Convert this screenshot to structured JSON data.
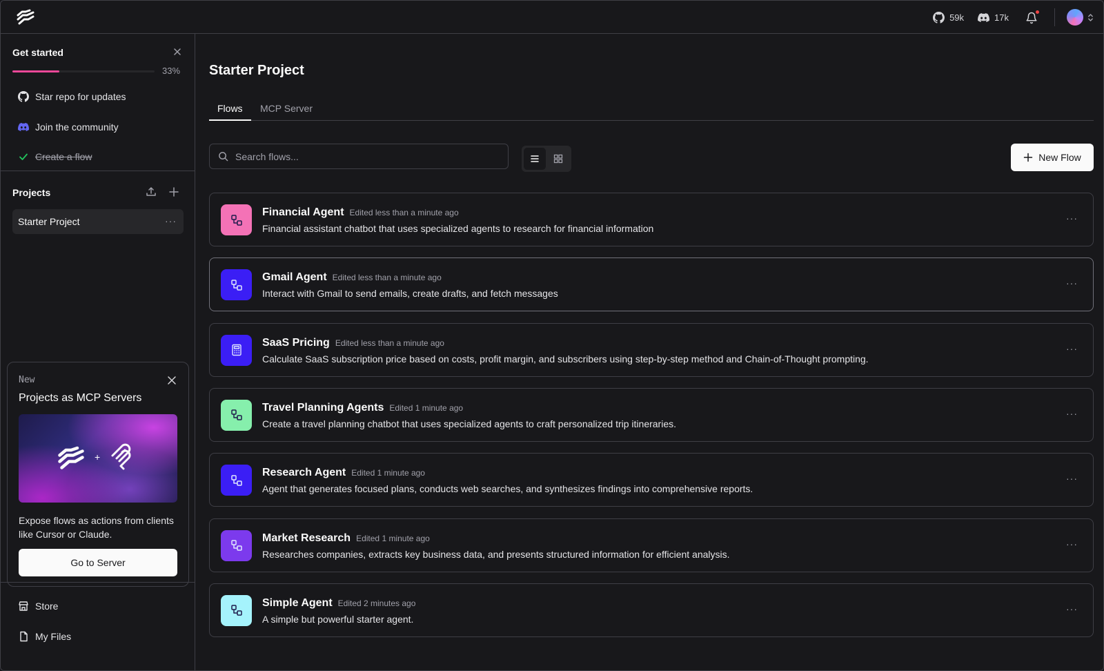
{
  "header": {
    "github_count": "59k",
    "discord_count": "17k"
  },
  "sidebar": {
    "get_started": {
      "title": "Get started",
      "progress_percent": 33,
      "progress_label": "33%",
      "items": [
        {
          "label": "Star repo for updates",
          "icon": "github-icon",
          "done": false
        },
        {
          "label": "Join the community",
          "icon": "discord-icon",
          "done": false
        },
        {
          "label": "Create a flow",
          "icon": "check-icon",
          "done": true
        }
      ]
    },
    "projects": {
      "title": "Projects",
      "items": [
        {
          "label": "Starter Project",
          "selected": true
        }
      ]
    },
    "promo": {
      "badge": "New",
      "title": "Projects as MCP Servers",
      "description": "Expose flows as actions from clients like Cursor or Claude.",
      "button": "Go to Server"
    },
    "bottom": [
      {
        "label": "Store",
        "icon": "store-icon"
      },
      {
        "label": "My Files",
        "icon": "file-icon"
      }
    ]
  },
  "main": {
    "title": "Starter Project",
    "tabs": [
      {
        "label": "Flows",
        "active": true
      },
      {
        "label": "MCP Server",
        "active": false
      }
    ],
    "search_placeholder": "Search flows...",
    "new_flow_label": "New Flow",
    "view_mode": "list",
    "flows": [
      {
        "name": "Financial Agent",
        "edited": "Edited less than a minute ago",
        "description": "Financial assistant chatbot that uses specialized agents to research for financial information",
        "color": "#f472b6",
        "icon": "workflow-icon"
      },
      {
        "name": "Gmail Agent",
        "edited": "Edited less than a minute ago",
        "description": "Interact with Gmail to send emails, create drafts, and fetch messages",
        "color": "#3b1ef5",
        "icon": "workflow-icon"
      },
      {
        "name": "SaaS Pricing",
        "edited": "Edited less than a minute ago",
        "description": "Calculate SaaS subscription price based on costs, profit margin, and subscribers using step-by-step method and Chain-of-Thought prompting.",
        "color": "#3b1ef5",
        "icon": "calculator-icon"
      },
      {
        "name": "Travel Planning Agents",
        "edited": "Edited 1 minute ago",
        "description": "Create a travel planning chatbot that uses specialized agents to craft personalized trip itineraries.",
        "color": "#86efac",
        "icon": "workflow-icon"
      },
      {
        "name": "Research Agent",
        "edited": "Edited 1 minute ago",
        "description": "Agent that generates focused plans, conducts web searches, and synthesizes findings into comprehensive reports.",
        "color": "#3b1ef5",
        "icon": "workflow-icon"
      },
      {
        "name": "Market Research",
        "edited": "Edited 1 minute ago",
        "description": "Researches companies, extracts key business data, and presents structured information for efficient analysis.",
        "color": "#7c3aed",
        "icon": "workflow-icon"
      },
      {
        "name": "Simple Agent",
        "edited": "Edited 2 minutes ago",
        "description": "A simple but powerful starter agent.",
        "color": "#a5f3fc",
        "icon": "workflow-icon"
      }
    ]
  }
}
